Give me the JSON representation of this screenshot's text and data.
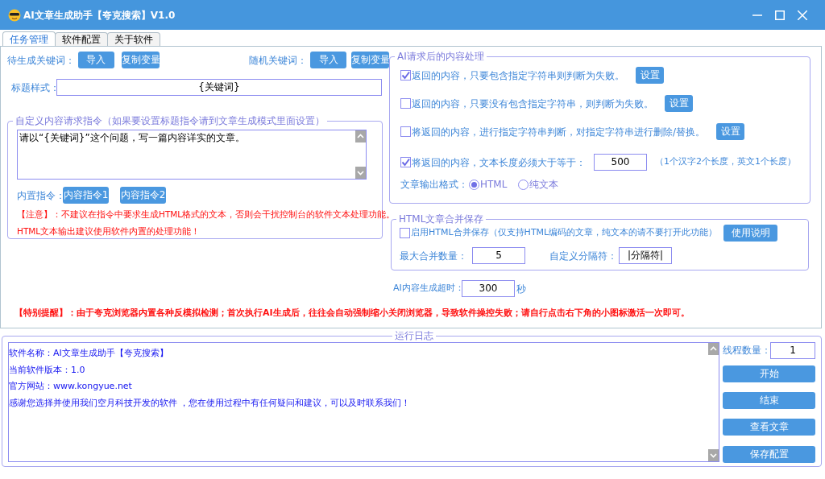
{
  "window": {
    "title": "AI文章生成助手【夸克搜索】V1.0"
  },
  "tabs": [
    {
      "label": "任务管理",
      "selected": true
    },
    {
      "label": "软件配置",
      "selected": false
    },
    {
      "label": "关于软件",
      "selected": false
    }
  ],
  "keywords": {
    "pending_label": "待生成关键词：",
    "pending_buttons": [
      "导入",
      "复制变量"
    ],
    "random_label": "随机关键词：",
    "random_buttons": [
      "导入",
      "复制变量"
    ]
  },
  "title_style": {
    "label": "标题样式：",
    "value": "{关键词}"
  },
  "custom_prompt": {
    "legend": "自定义内容请求指令（如果要设置标题指令请到文章生成模式里面设置）",
    "value": "请以“{关键词}”这个问题，写一篇内容详实的文章。",
    "builtin_label": "内置指令：",
    "builtin_buttons": [
      "内容指令1",
      "内容指令2"
    ],
    "notes": [
      "【注意】：不建议在指令中要求生成HTML格式的文本，否则会干扰控制台的软件文本处理功能。",
      "HTML文本输出建议使用软件内置的处理功能！"
    ]
  },
  "post_processing": {
    "legend": "AI请求后的内容处理",
    "rules": [
      {
        "kind": "button",
        "checked": true,
        "label": "返回的内容，只要包含指定字符串则判断为失败。",
        "button": "设置"
      },
      {
        "kind": "button",
        "checked": false,
        "label": "返回的内容，只要没有包含指定字符串，则判断为失败。",
        "button": "设置"
      },
      {
        "kind": "button",
        "checked": false,
        "label": "将返回的内容，进行指定字符串判断，对指定字符串进行删除/替换。",
        "button": "设置"
      },
      {
        "kind": "length",
        "checked": true,
        "label": "将返回的内容，文本长度必须大于等于：",
        "value": "500",
        "hint": "（1个汉字2个长度，英文1个长度）"
      }
    ],
    "format_label": "文章输出格式：",
    "formats": [
      {
        "label": "HTML",
        "selected": true
      },
      {
        "label": "纯文本",
        "selected": false
      }
    ]
  },
  "html_merge": {
    "legend": "HTML文章合并保存",
    "enabled": false,
    "label": "启用HTML合并保存（仅支持HTML编码的文章，纯文本的请不要打开此功能）",
    "button": "使用说明",
    "max_label": "最大合并数量：",
    "max_value": "5",
    "separator_label": "自定义分隔符：",
    "separator_value": "|分隔符|"
  },
  "timeout": {
    "label": "AI内容生成超时：",
    "value": "300",
    "unit": "秒"
  },
  "warning": "【特别提醒】：由于夸克浏览器内置各种反模拟检测；首次执行AI生成后，往往会自动强制缩小关闭浏览器，导致软件操控失败；请自行点击右下角的小图标激活一次即可。",
  "log": {
    "legend": "运行日志",
    "lines": [
      "软件名称：AI文章生成助手【夸克搜索】",
      "当前软件版本：1.0",
      "官方网站：www.kongyue.net",
      "感谢您选择并使用我们空月科技开发的软件 ，您在使用过程中有任何疑问和建议，可以及时联系我们！"
    ]
  },
  "threads": {
    "label": "线程数量：",
    "value": "1"
  },
  "actions": [
    "开始",
    "结束",
    "查看文章",
    "保存配置"
  ]
}
